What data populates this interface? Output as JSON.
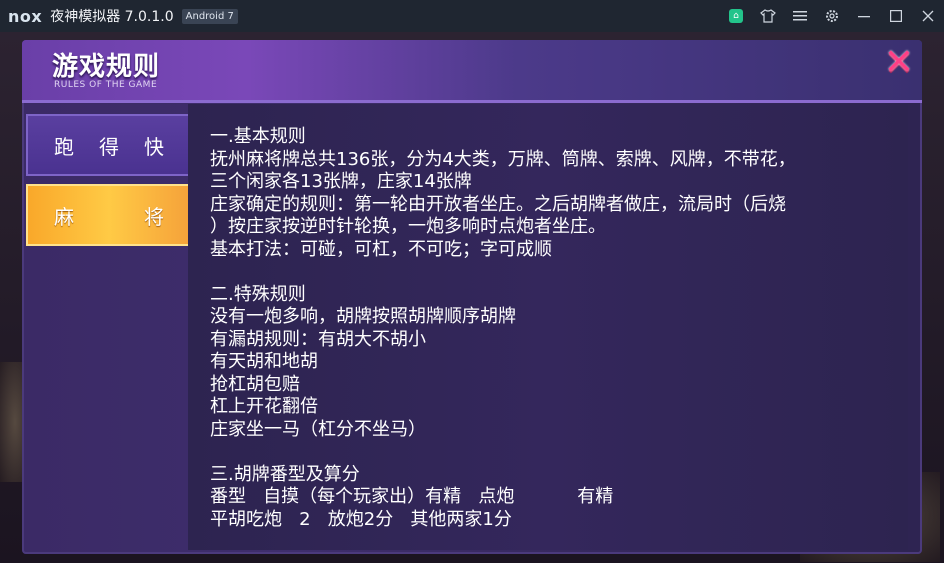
{
  "titlebar": {
    "logo_text": "nox",
    "app_title": "夜神模拟器 7.0.1.0",
    "android_badge": "Android 7",
    "icons": [
      "store-icon",
      "shirt-icon",
      "menu-icon",
      "gear-icon",
      "minimize-icon",
      "maximize-icon",
      "close-icon"
    ]
  },
  "panel": {
    "title": "游戏规则",
    "subtitle": "RULES OF THE GAME",
    "close_symbol": "✕"
  },
  "tabs": [
    {
      "label_chars": [
        "跑",
        "得",
        "快"
      ],
      "active": false
    },
    {
      "label_chars": [
        "麻",
        "将"
      ],
      "active": true
    }
  ],
  "rules_lines": [
    "一.基本规则",
    "抚州麻将牌总共136张，分为4大类，万牌、筒牌、索牌、风牌，不带花，",
    "三个闲家各13张牌，庄家14张牌",
    "庄家确定的规则：第一轮由开放者坐庄。之后胡牌者做庄，流局时（后烧",
    "）按庄家按逆时针轮换，一炮多响时点炮者坐庄。",
    "基本打法：可碰，可杠，不可吃；字可成顺",
    "",
    "二.特殊规则",
    "没有一炮多响，胡牌按照胡牌顺序胡牌",
    "有漏胡规则：有胡大不胡小",
    "有天胡和地胡",
    "抢杠胡包赔",
    "杠上开花翻倍",
    "庄家坐一马（杠分不坐马）",
    "",
    "三.胡牌番型及算分",
    "番型   自摸（每个玩家出）有精   点炮           有精",
    "平胡吃炮   2   放炮2分   其他两家1分"
  ],
  "colors": {
    "titlebar": "#1f2631",
    "panel": "#3b2a66",
    "active_tab": "#ffca45",
    "inactive_tab": "#5a3fa0",
    "close": "#ff3f86"
  }
}
